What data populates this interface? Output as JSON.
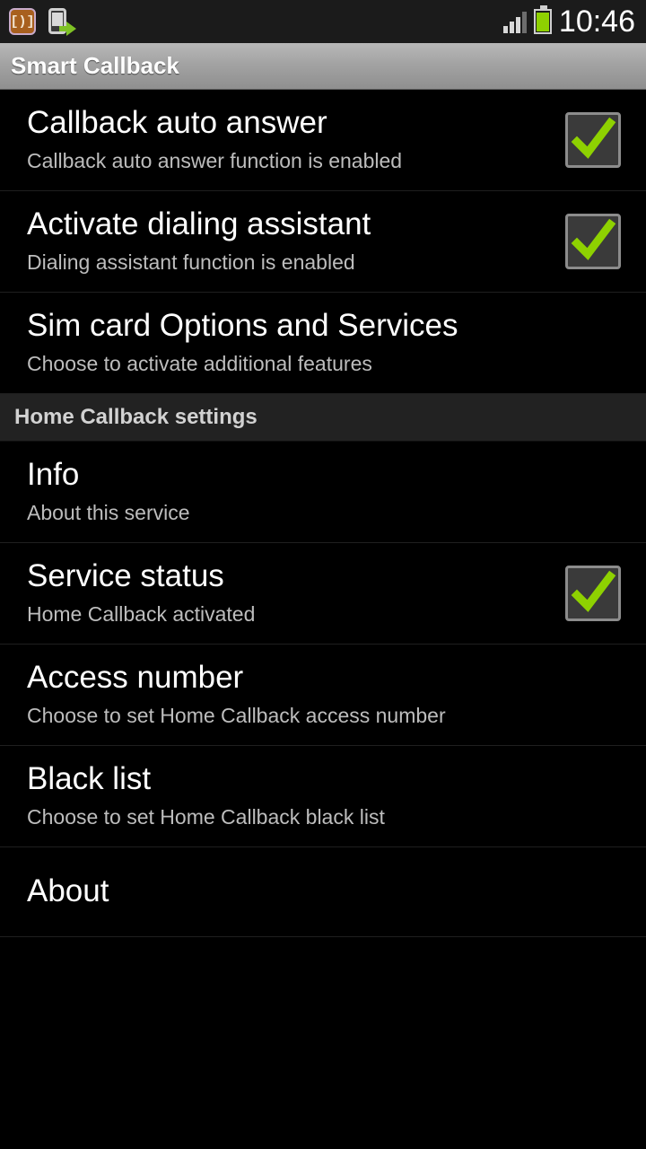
{
  "status_bar": {
    "icons": [
      "sim-toolkit-icon",
      "call-forward-icon",
      "signal-icon",
      "battery-icon"
    ],
    "clock": "10:46",
    "sim_icon_glyph": "[)]"
  },
  "header": {
    "title": "Smart Callback"
  },
  "colors": {
    "accent_green": "#8ed101",
    "background": "#000000",
    "titlebar": "#a3a3a3",
    "secondary_text": "#bdbdbd"
  },
  "list": [
    {
      "kind": "item",
      "name": "callback-auto-answer",
      "primary": "Callback auto answer",
      "secondary": "Callback auto answer function is enabled",
      "checkbox": true,
      "checked": true
    },
    {
      "kind": "item",
      "name": "activate-dialing-assistant",
      "primary": "Activate dialing assistant",
      "secondary": "Dialing assistant function is enabled",
      "checkbox": true,
      "checked": true
    },
    {
      "kind": "item",
      "name": "sim-card-options-and-services",
      "primary": "Sim card Options and Services",
      "secondary": "Choose to activate additional features",
      "checkbox": false,
      "checked": false
    },
    {
      "kind": "section",
      "name": "home-callback-settings",
      "primary": "Home Callback settings"
    },
    {
      "kind": "item",
      "name": "info",
      "primary": "Info",
      "secondary": "About this service",
      "checkbox": false,
      "checked": false
    },
    {
      "kind": "item",
      "name": "service-status",
      "primary": "Service status",
      "secondary": "Home Callback activated",
      "checkbox": true,
      "checked": true
    },
    {
      "kind": "item",
      "name": "access-number",
      "primary": "Access number",
      "secondary": "Choose to set Home Callback access number",
      "checkbox": false,
      "checked": false
    },
    {
      "kind": "item",
      "name": "black-list",
      "primary": "Black list",
      "secondary": "Choose to set Home Callback black list",
      "checkbox": false,
      "checked": false
    },
    {
      "kind": "item",
      "name": "about",
      "primary": "About",
      "secondary": "",
      "checkbox": false,
      "checked": false
    }
  ]
}
